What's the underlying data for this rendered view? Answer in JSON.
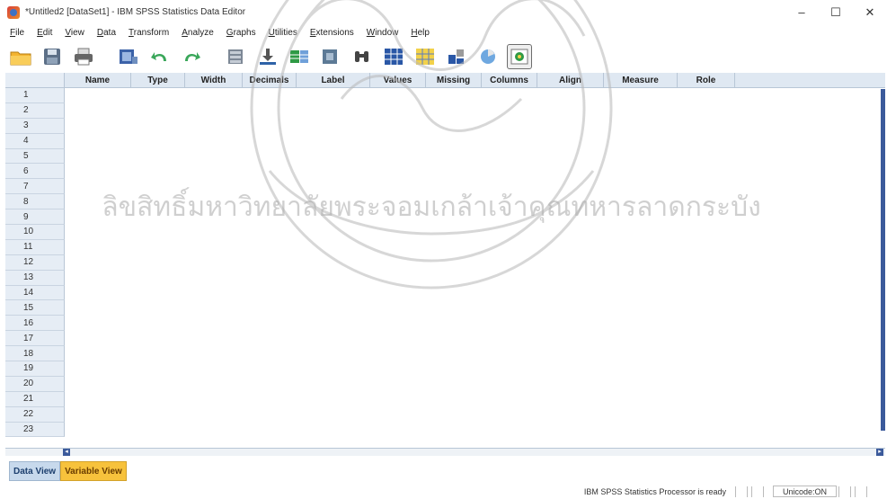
{
  "window": {
    "title": "*Untitled2 [DataSet1] - IBM SPSS Statistics Data Editor",
    "controls": [
      "–",
      "☐",
      "✕"
    ]
  },
  "menu": [
    "File",
    "Edit",
    "View",
    "Data",
    "Transform",
    "Analyze",
    "Graphs",
    "Utilities",
    "Extensions",
    "Window",
    "Help"
  ],
  "toolbar": {
    "icons": [
      "open-folder-icon",
      "save-icon",
      "print-icon",
      "dialog-recall-icon",
      "undo-icon",
      "redo-icon",
      "goto-case-icon",
      "goto-variable-icon",
      "variables-icon",
      "run-descriptives-icon",
      "find-icon",
      "insert-cases-icon",
      "insert-variable-icon",
      "split-file-icon",
      "weight-cases-icon",
      "value-labels-icon"
    ]
  },
  "grid": {
    "columns": [
      "Name",
      "Type",
      "Width",
      "Decimals",
      "Label",
      "Values",
      "Missing",
      "Columns",
      "Align",
      "Measure",
      "Role"
    ],
    "rows": [
      "1",
      "2",
      "3",
      "4",
      "5",
      "6",
      "7",
      "8",
      "9",
      "10",
      "11",
      "12",
      "13",
      "14",
      "15",
      "16",
      "17",
      "18",
      "19",
      "20",
      "21",
      "22",
      "23"
    ]
  },
  "tabs": {
    "data_view": "Data View",
    "variable_view": "Variable View"
  },
  "status": {
    "processor": "IBM SPSS Statistics Processor is ready",
    "unicode": "Unicode:ON"
  },
  "watermark": {
    "text": "ลิขสิทธิ์มหาวิทยาลัยพระจอมเกล้าเจ้าคุณทหารลาดกระบัง"
  }
}
